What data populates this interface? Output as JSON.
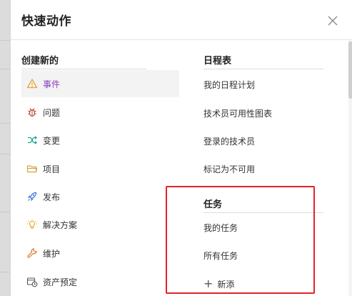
{
  "dialog": {
    "title": "快速动作",
    "close_icon": "close-icon"
  },
  "create_new": {
    "title": "创建新的",
    "items": [
      {
        "label": "事件",
        "icon": "warning-triangle-icon",
        "selected": true
      },
      {
        "label": "问题",
        "icon": "bug-icon"
      },
      {
        "label": "变更",
        "icon": "shuffle-icon"
      },
      {
        "label": "项目",
        "icon": "folder-icon"
      },
      {
        "label": "发布",
        "icon": "rocket-icon"
      },
      {
        "label": "解决方案",
        "icon": "lightbulb-icon"
      },
      {
        "label": "维护",
        "icon": "wrench-icon"
      },
      {
        "label": "资产预定",
        "icon": "calendar-clock-icon"
      }
    ]
  },
  "schedule": {
    "title": "日程表",
    "items": [
      {
        "label": "我的日程计划"
      },
      {
        "label": "技术员可用性图表"
      },
      {
        "label": "登录的技术员"
      },
      {
        "label": "标记为不可用"
      }
    ]
  },
  "tasks": {
    "title": "任务",
    "items": [
      {
        "label": "我的任务"
      },
      {
        "label": "所有任务"
      }
    ],
    "add_label": "新添"
  },
  "colors": {
    "accent": "#8a3fbf",
    "highlight": "#e0242b",
    "warning": "#e8a33b",
    "bug": "#c0392b",
    "shuffle": "#19a88f",
    "folder": "#d8a24a",
    "rocket": "#3b6fd1",
    "lightbulb": "#e3a417",
    "wrench": "#e17b2f",
    "calendar": "#555555"
  }
}
